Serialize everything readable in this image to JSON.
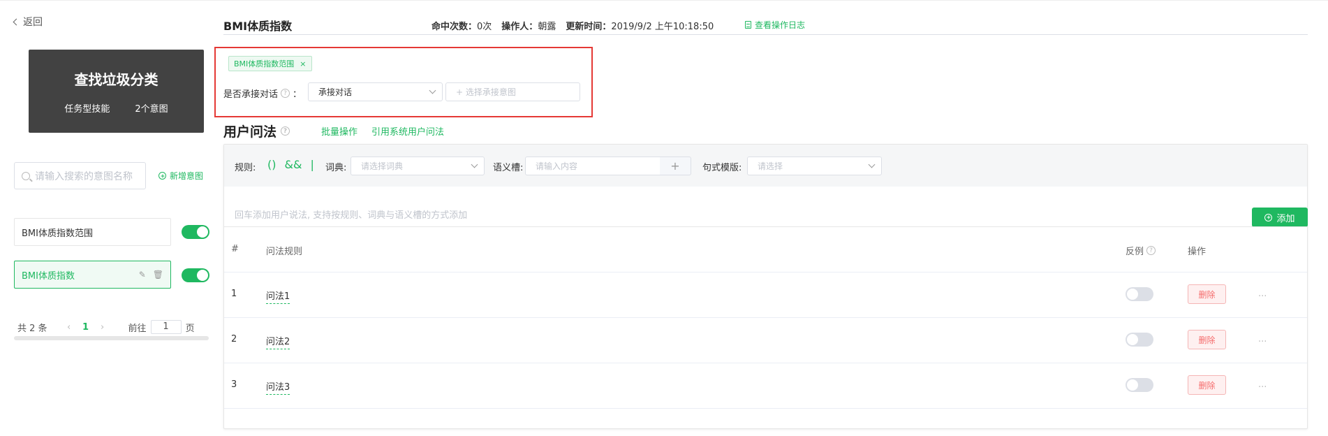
{
  "nav": {
    "back_label": "返回"
  },
  "skill": {
    "title": "查找垃圾分类",
    "type": "任务型技能",
    "intent_count": "2个意图"
  },
  "sidebar": {
    "search_placeholder": "请输入搜索的意图名称",
    "add_intent_label": "新增意图",
    "intents": [
      {
        "label": "BMI体质指数范围",
        "enabled": true,
        "active": false
      },
      {
        "label": "BMI体质指数",
        "enabled": true,
        "active": true
      }
    ],
    "pagination": {
      "total": "共 2 条",
      "current_page": "1",
      "goto_label": "前往",
      "goto_value": "1",
      "page_suffix": "页"
    }
  },
  "header": {
    "title": "BMI体质指数",
    "hit_label": "命中次数：",
    "hit_value": "0次",
    "operator_label": "操作人：",
    "operator_value": "朝露",
    "updated_label": "更新时间：",
    "updated_value": "2019/9/2 上午10:18:50",
    "log_link": "查看操作日志"
  },
  "follow": {
    "tag": "BMI体质指数范围",
    "label": "是否承接对话",
    "colon": "：",
    "select_value": "承接对话",
    "intent_placeholder": "+ 选择承接意图"
  },
  "utterances": {
    "title": "用户问法",
    "batch_label": "批量操作",
    "reference_label": "引用系统用户问法",
    "toolbar": {
      "rule_label": "规则:",
      "rule_ops": [
        "()",
        "&&",
        "|"
      ],
      "dict_label": "词典:",
      "dict_placeholder": "请选择词典",
      "slot_label": "语义槽:",
      "slot_placeholder": "请输入内容",
      "slot_add": "+",
      "template_label": "句式模版:",
      "template_placeholder": "请选择"
    },
    "input_hint": "回车添加用户说法, 支持按规则、词典与语义槽的方式添加",
    "add_button": "添加",
    "columns": {
      "index": "#",
      "rule": "问法规则",
      "counter": "反例",
      "action": "操作"
    },
    "rows": [
      {
        "index": "1",
        "rule": "问法1",
        "counter": false,
        "delete": "删除",
        "more": "..."
      },
      {
        "index": "2",
        "rule": "问法2",
        "counter": false,
        "delete": "删除",
        "more": "..."
      },
      {
        "index": "3",
        "rule": "问法3",
        "counter": false,
        "delete": "删除",
        "more": "..."
      }
    ]
  },
  "colors": {
    "accent": "#1fb860",
    "danger": "#f56c6c",
    "highlight_box": "#e53935",
    "card_bg": "#424242"
  }
}
